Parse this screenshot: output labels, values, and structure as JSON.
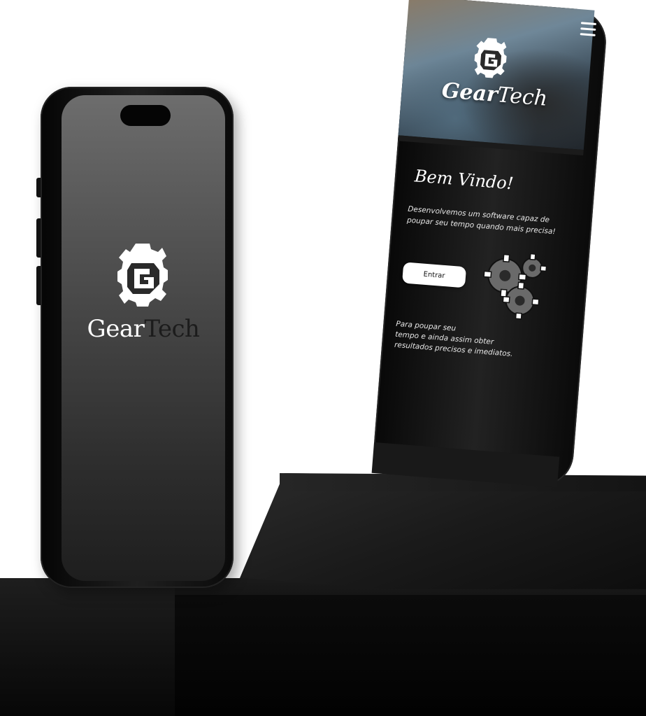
{
  "splash": {
    "brand_part1": "Gear",
    "brand_part2": "Tech"
  },
  "landing": {
    "hero": {
      "brand_part1": "Gear",
      "brand_part2": "Tech",
      "menu_icon": "hamburger-menu-icon"
    },
    "welcome_title": "Bem Vindo!",
    "welcome_description": "Desenvolvemos um software capaz de poupar seu tempo quando mais precisa!",
    "enter_label": "Entrar",
    "sub_description_line1": "Para poupar seu",
    "sub_description_line2": "tempo e ainda assim obter",
    "sub_description_line3": "resultados precisos e imediatos."
  },
  "icons": {
    "logo": "gear-g-logo-icon",
    "gears": "gears-icon"
  },
  "colors": {
    "splash_brand_light": "#ffffff",
    "splash_brand_dark": "#1c1c1c",
    "button_bg": "#ffffff",
    "screen_dark": "#2f2f2f"
  }
}
